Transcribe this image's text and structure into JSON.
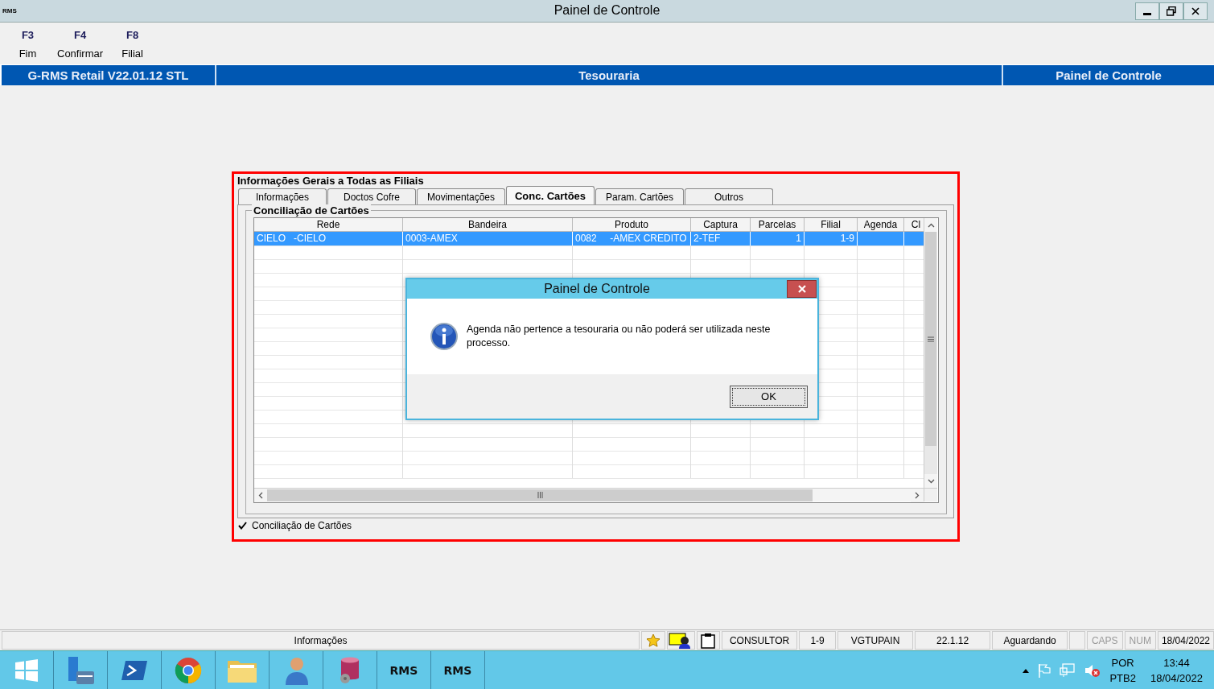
{
  "window": {
    "icon": "RMS",
    "title": "Painel de Controle"
  },
  "toolbar": [
    {
      "key": "F3",
      "label": "Fim"
    },
    {
      "key": "F4",
      "label": "Confirmar"
    },
    {
      "key": "F8",
      "label": "Filial"
    }
  ],
  "header": {
    "app": "G-RMS Retail V22.01.12 STL",
    "module": "Tesouraria",
    "screen": "Painel de Controle"
  },
  "panel": {
    "title": "Informações Gerais a Todas as Filiais",
    "tabs": [
      {
        "label": "Informações",
        "selected": false
      },
      {
        "label": "Doctos Cofre",
        "selected": false
      },
      {
        "label": "Movimentações",
        "selected": false
      },
      {
        "label": "Conc. Cartões",
        "selected": true
      },
      {
        "label": "Param. Cartões",
        "selected": false
      },
      {
        "label": "Outros",
        "selected": false
      }
    ],
    "group_title": "Conciliação de Cartões",
    "table": {
      "columns": [
        {
          "label": "Rede"
        },
        {
          "label": "Bandeira"
        },
        {
          "label": "Produto"
        },
        {
          "label": "Captura"
        },
        {
          "label": "Parcelas"
        },
        {
          "label": "Filial"
        },
        {
          "label": "Agenda"
        },
        {
          "label": "Cl"
        }
      ],
      "rows": [
        {
          "selected": true,
          "cells": [
            "CIELO   -CIELO",
            "0003-AMEX",
            "0082     -AMEX CREDITO",
            "2-TEF",
            "1",
            "1-9",
            "",
            ""
          ]
        }
      ]
    },
    "checkbox": {
      "label": "Conciliação de Cartões",
      "checked": true
    }
  },
  "dialog": {
    "title": "Painel de Controle",
    "message": "Agenda não pertence a tesouraria ou não poderá ser utilizada neste processo.",
    "button": "OK"
  },
  "status_bar": {
    "info": "Informações",
    "fields": [
      "CONSULTOR",
      "1-9",
      "VGTUPAIN",
      "22.1.12",
      "Aguardando"
    ],
    "indicators": [
      {
        "label": "CAPS",
        "on": false
      },
      {
        "label": "NUM",
        "on": false
      }
    ],
    "date": "18/04/2022"
  },
  "taskbar": {
    "apps": [
      {
        "kind": "start"
      },
      {
        "kind": "server"
      },
      {
        "kind": "shell"
      },
      {
        "kind": "browser"
      },
      {
        "kind": "folder"
      },
      {
        "kind": "user"
      },
      {
        "kind": "database"
      },
      {
        "kind": "rms",
        "label": "RMS"
      },
      {
        "kind": "rms",
        "label": "RMS"
      }
    ],
    "language": "POR",
    "layout": "PTB2",
    "time": "13:44",
    "date": "18/04/2022"
  }
}
